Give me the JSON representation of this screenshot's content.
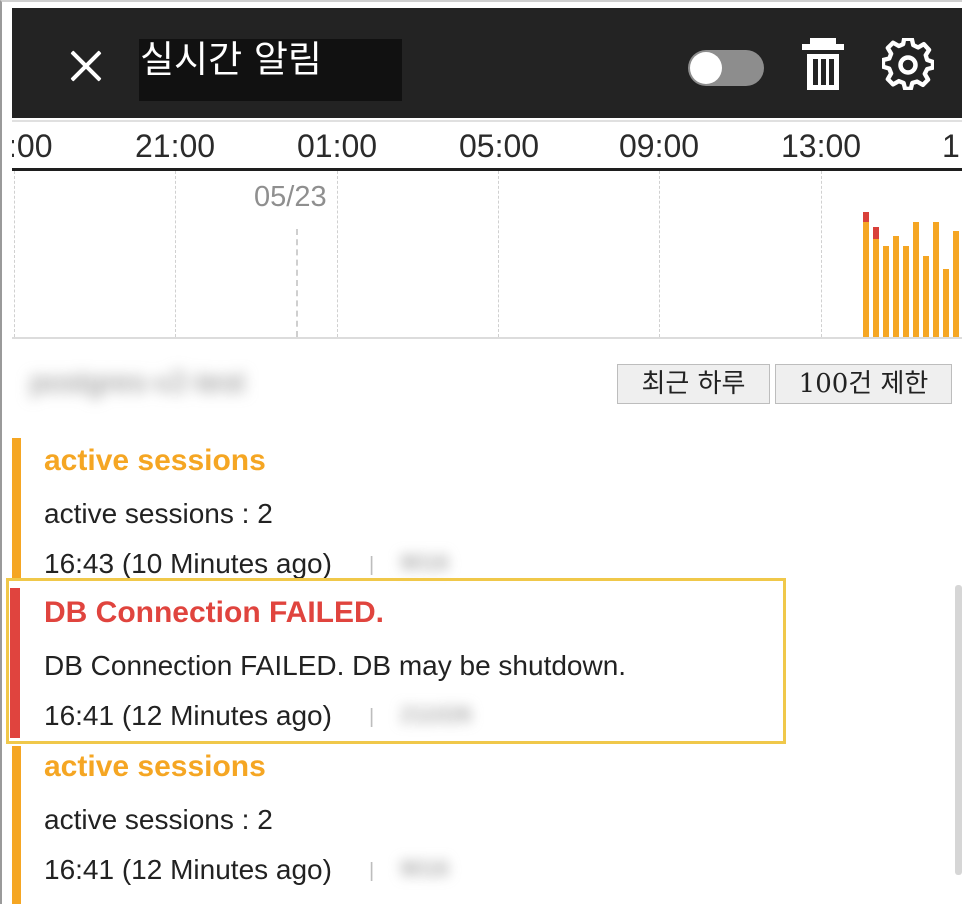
{
  "header": {
    "title": "실시간 알림",
    "toggle_state": "off"
  },
  "timeline": {
    "ticks": [
      ":00",
      "21:00",
      "01:00",
      "05:00",
      "09:00",
      "13:00",
      "1"
    ],
    "day_marker": "05/23",
    "bar_color": "#f5a623",
    "error_color": "#d9403a",
    "bars": [
      {
        "level": 0.75,
        "error": 0.06
      },
      {
        "level": 0.66,
        "error": 0.07
      },
      {
        "level": 0.55,
        "error": 0
      },
      {
        "level": 0.61,
        "error": 0
      },
      {
        "level": 0.55,
        "error": 0
      },
      {
        "level": 0.69,
        "error": 0
      },
      {
        "level": 0.49,
        "error": 0
      },
      {
        "level": 0.69,
        "error": 0
      },
      {
        "level": 0.41,
        "error": 0
      },
      {
        "level": 0.64,
        "error": 0
      }
    ]
  },
  "source": {
    "name": "postgres-v2-test"
  },
  "filters": [
    {
      "label": "최근 하루"
    },
    {
      "label": "100건 제한"
    }
  ],
  "alerts": [
    {
      "level": "warning",
      "title": "active sessions",
      "message": "active sessions : 2",
      "time": "16:43 (10 Minutes ago)",
      "host": "9016",
      "color": "#f5a623"
    },
    {
      "level": "critical",
      "title": "DB Connection FAILED.",
      "message": "DB Connection FAILED. DB may be shutdown.",
      "time": "16:41 (12 Minutes ago)",
      "host": "211026",
      "color": "#e0443e"
    },
    {
      "level": "warning",
      "title": "active sessions",
      "message": "active sessions : 2",
      "time": "16:41 (12 Minutes ago)",
      "host": "9016",
      "color": "#f5a623"
    }
  ],
  "separator": "|",
  "icons": {
    "close": "close-icon",
    "toggle": "toggle-switch",
    "trash": "trash-icon",
    "settings": "gear-icon"
  }
}
